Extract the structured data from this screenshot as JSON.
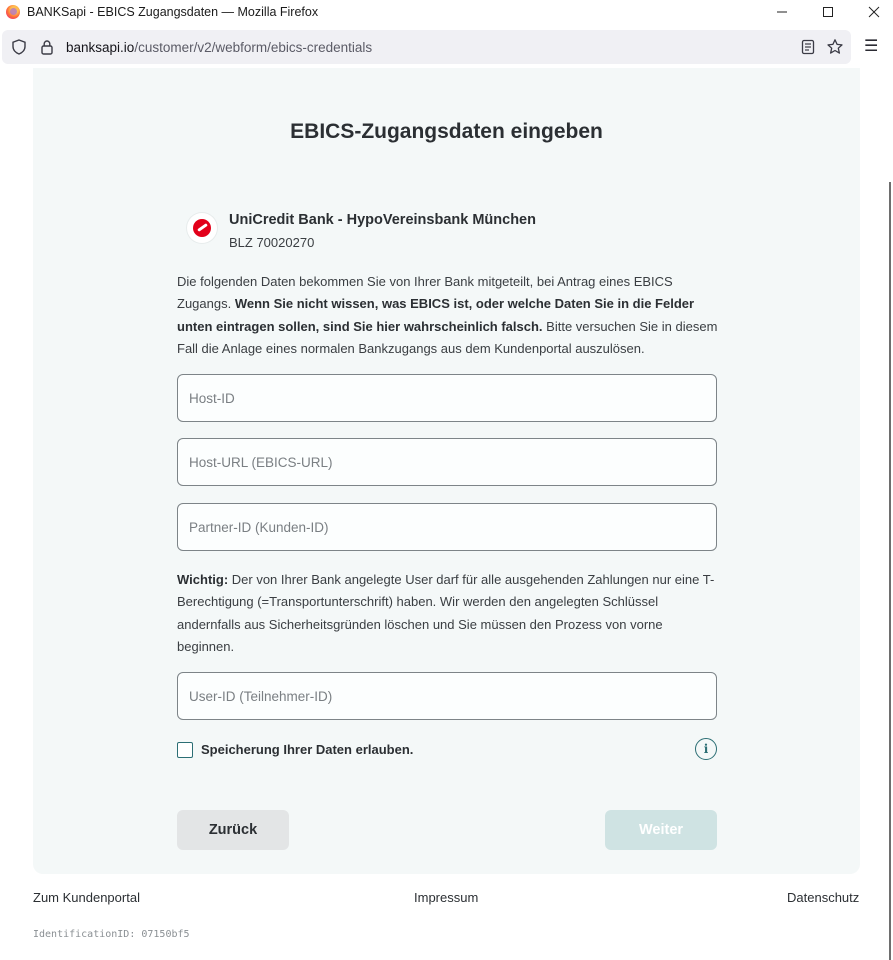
{
  "window": {
    "title": "BANKSapi - EBICS Zugangsdaten — Mozilla Firefox",
    "minimize_glyph": "—",
    "maximize_glyph": "☐",
    "close_glyph": "✕"
  },
  "browser": {
    "url_host": "banksapi.io",
    "url_path": "/customer/v2/webform/ebics-credentials",
    "menu_glyph": "☰"
  },
  "page": {
    "heading": "EBICS-Zugangsdaten eingeben",
    "bank": {
      "name": "UniCredit Bank - HypoVereinsbank München",
      "blz": "BLZ 70020270"
    },
    "intro": {
      "text1": "Die folgenden Daten bekommen Sie von Ihrer Bank mitgeteilt, bei Antrag eines EBICS Zugangs. ",
      "bold": "Wenn Sie nicht wissen, was EBICS ist, oder welche Daten Sie in die Felder unten eintragen sollen, sind Sie hier wahrscheinlich falsch.",
      "text2": " Bitte versuchen Sie in diesem Fall die Anlage eines normalen Bankzugangs aus dem Kundenportal auszulösen."
    },
    "fields": {
      "host_id": {
        "placeholder": "Host-ID",
        "value": ""
      },
      "host_url": {
        "placeholder": "Host-URL (EBICS-URL)",
        "value": ""
      },
      "partner_id": {
        "placeholder": "Partner-ID (Kunden-ID)",
        "value": ""
      },
      "user_id": {
        "placeholder": "User-ID (Teilnehmer-ID)",
        "value": ""
      }
    },
    "warning": {
      "bold": "Wichtig:",
      "text": " Der von Ihrer Bank angelegte User darf für alle ausgehenden Zahlungen nur eine T-Berechtigung (=Transportunterschrift) haben. Wir werden den angelegten Schlüssel andernfalls aus Sicherheitsgründen löschen und Sie müssen den Prozess von vorne beginnen."
    },
    "consent": {
      "label": "Speicherung Ihrer Daten erlauben.",
      "checked": false,
      "info_glyph": "i"
    },
    "buttons": {
      "back": "Zurück",
      "next": "Weiter"
    }
  },
  "footer": {
    "portal": "Zum Kundenportal",
    "imprint": "Impressum",
    "privacy": "Datenschutz",
    "identification": "IdentificationID: 07150bf5"
  },
  "colors": {
    "card_bg": "#f4f8f8",
    "accent": "#2b6e74",
    "next_button_disabled": "#cfe3e3",
    "bank_red": "#e2001a"
  }
}
